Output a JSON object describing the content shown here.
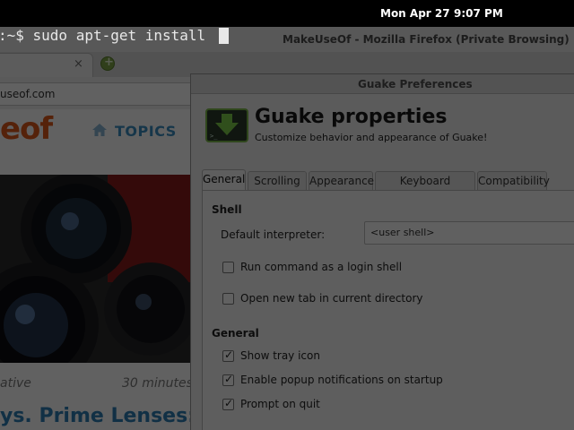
{
  "panel": {
    "date": "Mon Apr 27",
    "time": "9:07 PM"
  },
  "terminal": {
    "prompt": ":~$ sudo apt-get install"
  },
  "firefox": {
    "title": "MakeUseOf - Mozilla Firefox (Private Browsing)",
    "tab_close": "×",
    "new_tab": "+",
    "url": "useof.com",
    "logo": "eof",
    "topics": "TOPICS",
    "category": "ative",
    "time_ago": "30 minutes",
    "headline": "ys. Prime Lenses:"
  },
  "prefs": {
    "title": "Guake Preferences",
    "heading": "Guake properties",
    "subtitle": "Customize behavior and appearance of Guake!",
    "tabs": [
      "General",
      "Scrolling",
      "Appearance",
      "Keyboard shortcuts",
      "Compatibility"
    ],
    "shell": {
      "section": "Shell",
      "interpreter_label": "Default interpreter:",
      "interpreter_value": "<user shell>",
      "login_shell": "Run command as a login shell",
      "new_tab_dir": "Open new tab in current directory"
    },
    "general": {
      "section": "General",
      "tray_icon": "Show tray icon",
      "popup_notifications": "Enable popup notifications on startup",
      "prompt_quit": "Prompt on quit",
      "checkmark": "✓"
    }
  }
}
